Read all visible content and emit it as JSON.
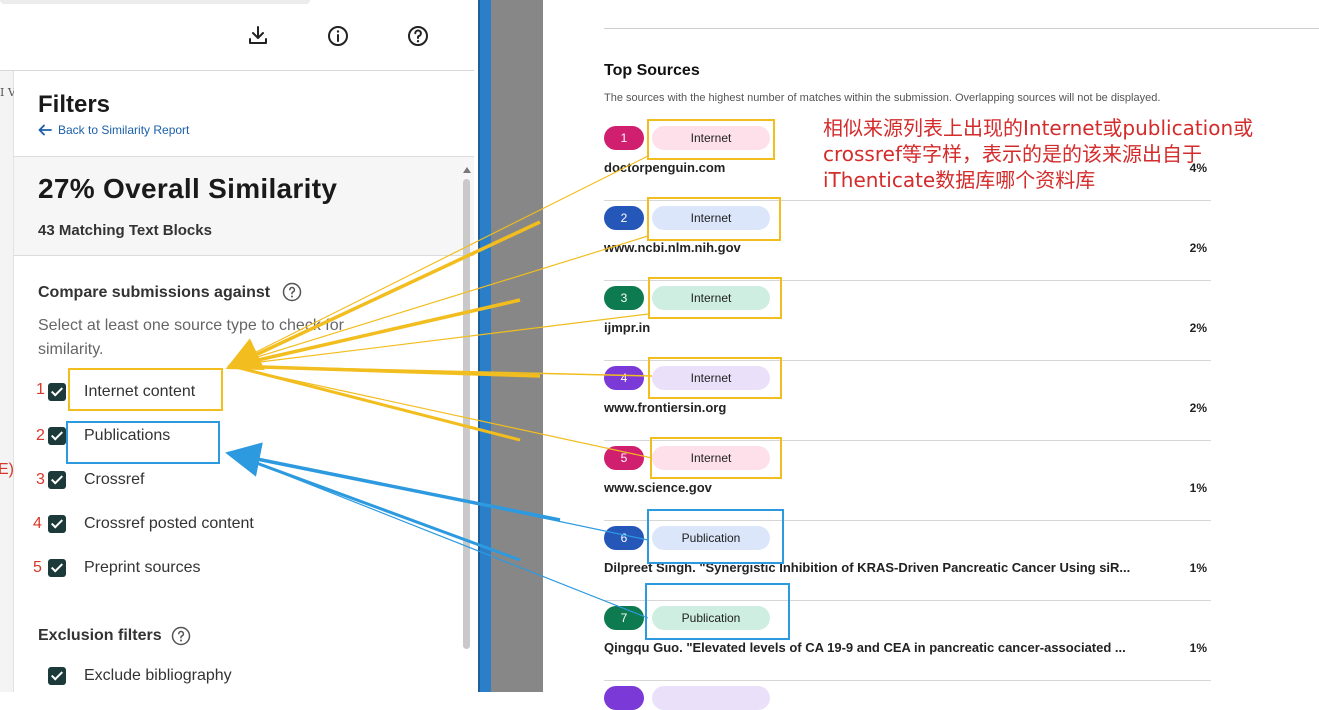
{
  "edge_fragment": "I V",
  "filters": {
    "title": "Filters",
    "back_link": "Back to Similarity Report",
    "similarity_title": "27% Overall Similarity",
    "matching_blocks": "43 Matching Text Blocks",
    "compare_label": "Compare submissions against",
    "compare_desc": "Select at least one source type to check for similarity.",
    "options": [
      {
        "num": "1",
        "label": "Internet content",
        "checked": true
      },
      {
        "num": "2",
        "label": "Publications",
        "checked": true
      },
      {
        "num": "3",
        "label": "Crossref",
        "checked": true
      },
      {
        "num": "4",
        "label": "Crossref posted content",
        "checked": true
      },
      {
        "num": "5",
        "label": "Preprint sources",
        "checked": true
      }
    ],
    "exclusion_label": "Exclusion filters",
    "exclusion_options": [
      {
        "label": "Exclude bibliography",
        "checked": true
      }
    ]
  },
  "side_fragment": "E)",
  "report": {
    "title": "Top Sources",
    "description": "The sources with the highest number of matches within the submission. Overlapping sources will not be displayed.",
    "sources": [
      {
        "num": "1",
        "type": "Internet",
        "name": "doctorpenguin.com",
        "percent": "4%",
        "num_color": "#cf1f6e",
        "tag_color": "#fde0ea"
      },
      {
        "num": "2",
        "type": "Internet",
        "name": "www.ncbi.nlm.nih.gov",
        "percent": "2%",
        "num_color": "#2457b8",
        "tag_color": "#dbe6fb"
      },
      {
        "num": "3",
        "type": "Internet",
        "name": "ijmpr.in",
        "percent": "2%",
        "num_color": "#0e7a4f",
        "tag_color": "#cdeee0"
      },
      {
        "num": "4",
        "type": "Internet",
        "name": "www.frontiersin.org",
        "percent": "2%",
        "num_color": "#7b39d8",
        "tag_color": "#ebe0fa"
      },
      {
        "num": "5",
        "type": "Internet",
        "name": "www.science.gov",
        "percent": "1%",
        "num_color": "#cf1f6e",
        "tag_color": "#fde0ea"
      },
      {
        "num": "6",
        "type": "Publication",
        "name": "Dilpreet Singh. \"Synergistic Inhibition of KRAS-Driven Pancreatic Cancer Using siR...",
        "percent": "1%",
        "num_color": "#2457b8",
        "tag_color": "#dbe6fb"
      },
      {
        "num": "7",
        "type": "Publication",
        "name": "Qingqu Guo. \"Elevated levels of CA 19-9 and CEA in pancreatic cancer-associated ...",
        "percent": "1%",
        "num_color": "#0e7a4f",
        "tag_color": "#cdeee0"
      }
    ]
  },
  "annotation": "相似来源列表上出现的Internet或publication或crossref等字样，表示的是的该来源出自于iThenticate数据库哪个资料库",
  "colors": {
    "highlight_yellow": "#f2bd1e",
    "highlight_blue": "#2d9ae0",
    "annotation_red": "#d42b2b",
    "divider_blue": "#2b7fc8"
  },
  "icons": {
    "toolbar": [
      "download-icon",
      "info-icon",
      "help-icon"
    ],
    "back": "arrow-left-icon"
  }
}
